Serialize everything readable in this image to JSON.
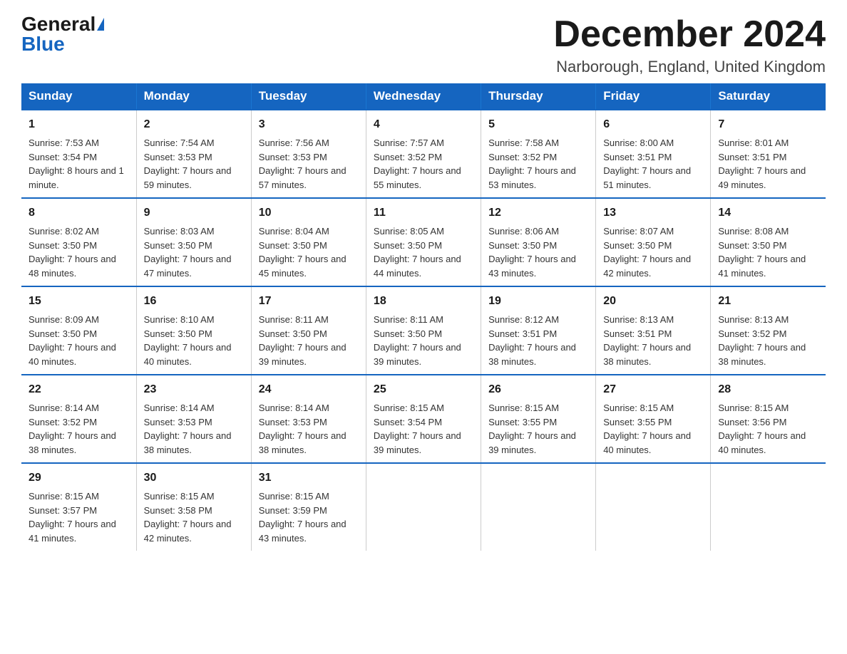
{
  "header": {
    "logo_general": "General",
    "logo_blue": "Blue",
    "title": "December 2024",
    "subtitle": "Narborough, England, United Kingdom"
  },
  "days_of_week": [
    "Sunday",
    "Monday",
    "Tuesday",
    "Wednesday",
    "Thursday",
    "Friday",
    "Saturday"
  ],
  "weeks": [
    [
      {
        "day": "1",
        "sunrise": "7:53 AM",
        "sunset": "3:54 PM",
        "daylight": "8 hours and 1 minute."
      },
      {
        "day": "2",
        "sunrise": "7:54 AM",
        "sunset": "3:53 PM",
        "daylight": "7 hours and 59 minutes."
      },
      {
        "day": "3",
        "sunrise": "7:56 AM",
        "sunset": "3:53 PM",
        "daylight": "7 hours and 57 minutes."
      },
      {
        "day": "4",
        "sunrise": "7:57 AM",
        "sunset": "3:52 PM",
        "daylight": "7 hours and 55 minutes."
      },
      {
        "day": "5",
        "sunrise": "7:58 AM",
        "sunset": "3:52 PM",
        "daylight": "7 hours and 53 minutes."
      },
      {
        "day": "6",
        "sunrise": "8:00 AM",
        "sunset": "3:51 PM",
        "daylight": "7 hours and 51 minutes."
      },
      {
        "day": "7",
        "sunrise": "8:01 AM",
        "sunset": "3:51 PM",
        "daylight": "7 hours and 49 minutes."
      }
    ],
    [
      {
        "day": "8",
        "sunrise": "8:02 AM",
        "sunset": "3:50 PM",
        "daylight": "7 hours and 48 minutes."
      },
      {
        "day": "9",
        "sunrise": "8:03 AM",
        "sunset": "3:50 PM",
        "daylight": "7 hours and 47 minutes."
      },
      {
        "day": "10",
        "sunrise": "8:04 AM",
        "sunset": "3:50 PM",
        "daylight": "7 hours and 45 minutes."
      },
      {
        "day": "11",
        "sunrise": "8:05 AM",
        "sunset": "3:50 PM",
        "daylight": "7 hours and 44 minutes."
      },
      {
        "day": "12",
        "sunrise": "8:06 AM",
        "sunset": "3:50 PM",
        "daylight": "7 hours and 43 minutes."
      },
      {
        "day": "13",
        "sunrise": "8:07 AM",
        "sunset": "3:50 PM",
        "daylight": "7 hours and 42 minutes."
      },
      {
        "day": "14",
        "sunrise": "8:08 AM",
        "sunset": "3:50 PM",
        "daylight": "7 hours and 41 minutes."
      }
    ],
    [
      {
        "day": "15",
        "sunrise": "8:09 AM",
        "sunset": "3:50 PM",
        "daylight": "7 hours and 40 minutes."
      },
      {
        "day": "16",
        "sunrise": "8:10 AM",
        "sunset": "3:50 PM",
        "daylight": "7 hours and 40 minutes."
      },
      {
        "day": "17",
        "sunrise": "8:11 AM",
        "sunset": "3:50 PM",
        "daylight": "7 hours and 39 minutes."
      },
      {
        "day": "18",
        "sunrise": "8:11 AM",
        "sunset": "3:50 PM",
        "daylight": "7 hours and 39 minutes."
      },
      {
        "day": "19",
        "sunrise": "8:12 AM",
        "sunset": "3:51 PM",
        "daylight": "7 hours and 38 minutes."
      },
      {
        "day": "20",
        "sunrise": "8:13 AM",
        "sunset": "3:51 PM",
        "daylight": "7 hours and 38 minutes."
      },
      {
        "day": "21",
        "sunrise": "8:13 AM",
        "sunset": "3:52 PM",
        "daylight": "7 hours and 38 minutes."
      }
    ],
    [
      {
        "day": "22",
        "sunrise": "8:14 AM",
        "sunset": "3:52 PM",
        "daylight": "7 hours and 38 minutes."
      },
      {
        "day": "23",
        "sunrise": "8:14 AM",
        "sunset": "3:53 PM",
        "daylight": "7 hours and 38 minutes."
      },
      {
        "day": "24",
        "sunrise": "8:14 AM",
        "sunset": "3:53 PM",
        "daylight": "7 hours and 38 minutes."
      },
      {
        "day": "25",
        "sunrise": "8:15 AM",
        "sunset": "3:54 PM",
        "daylight": "7 hours and 39 minutes."
      },
      {
        "day": "26",
        "sunrise": "8:15 AM",
        "sunset": "3:55 PM",
        "daylight": "7 hours and 39 minutes."
      },
      {
        "day": "27",
        "sunrise": "8:15 AM",
        "sunset": "3:55 PM",
        "daylight": "7 hours and 40 minutes."
      },
      {
        "day": "28",
        "sunrise": "8:15 AM",
        "sunset": "3:56 PM",
        "daylight": "7 hours and 40 minutes."
      }
    ],
    [
      {
        "day": "29",
        "sunrise": "8:15 AM",
        "sunset": "3:57 PM",
        "daylight": "7 hours and 41 minutes."
      },
      {
        "day": "30",
        "sunrise": "8:15 AM",
        "sunset": "3:58 PM",
        "daylight": "7 hours and 42 minutes."
      },
      {
        "day": "31",
        "sunrise": "8:15 AM",
        "sunset": "3:59 PM",
        "daylight": "7 hours and 43 minutes."
      },
      null,
      null,
      null,
      null
    ]
  ],
  "labels": {
    "sunrise_prefix": "Sunrise: ",
    "sunset_prefix": "Sunset: ",
    "daylight_prefix": "Daylight: "
  }
}
